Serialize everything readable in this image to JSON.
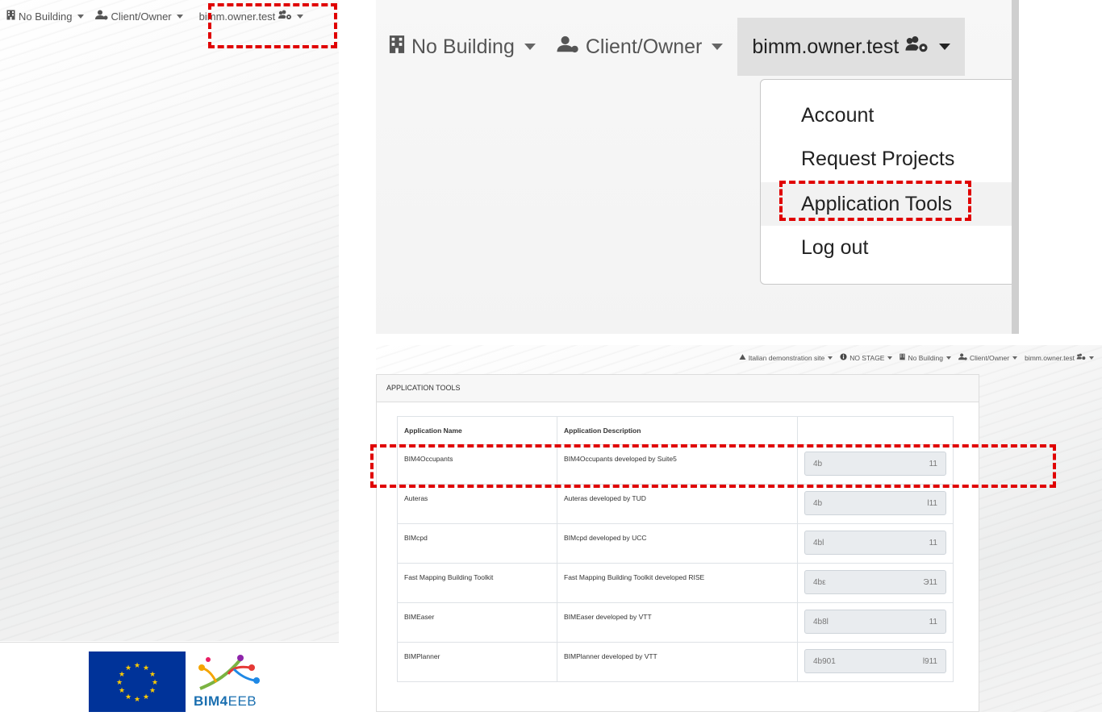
{
  "left_panel": {
    "nav": {
      "building_label": "No Building",
      "role_label": "Client/Owner",
      "user_label": "bimm.owner.test"
    },
    "footer": {
      "brand_text_main": "BIM4",
      "brand_text_sub": "EEB"
    }
  },
  "zoom_panel": {
    "nav": {
      "building_label": "No Building",
      "role_label": "Client/Owner",
      "user_label": "bimm.owner.test"
    },
    "menu": {
      "items": [
        "Account",
        "Request Projects",
        "Application Tools",
        "Log out"
      ],
      "highlighted_index": 2
    }
  },
  "tools_panel": {
    "nav": {
      "site_label": "Italian demonstration site",
      "stage_label": "NO STAGE",
      "building_label": "No Building",
      "role_label": "Client/Owner",
      "user_label": "bimm.owner.test"
    },
    "card_title": "APPLICATION TOOLS",
    "table": {
      "headers": [
        "Application Name",
        "Application Description",
        ""
      ],
      "rows": [
        {
          "name": "BIM4Occupants",
          "description": "BIM4Occupants developed by Suite5",
          "key_start": "4b",
          "key_end": "11"
        },
        {
          "name": "Auteras",
          "description": "Auteras developed by TUD",
          "key_start": "4b",
          "key_end": "l11"
        },
        {
          "name": "BIMcpd",
          "description": "BIMcpd developed by UCC",
          "key_start": "4bl",
          "key_end": "11"
        },
        {
          "name": "Fast Mapping Building Toolkit",
          "description": "Fast Mapping Building Toolkit developed RISE",
          "key_start": "4bε",
          "key_end": "Э11"
        },
        {
          "name": "BIMEaser",
          "description": "BIMEaser developed by VTT",
          "key_start": "4b8l",
          "key_end": "11"
        },
        {
          "name": "BIMPlanner",
          "description": "BIMPlanner developed by VTT",
          "key_start": "4b901",
          "key_end": "l911"
        }
      ]
    }
  },
  "colors": {
    "highlight": "#e00000",
    "eu_blue": "#003399",
    "eu_star": "#ffcc00",
    "brand_blue": "#1a6fb0"
  }
}
